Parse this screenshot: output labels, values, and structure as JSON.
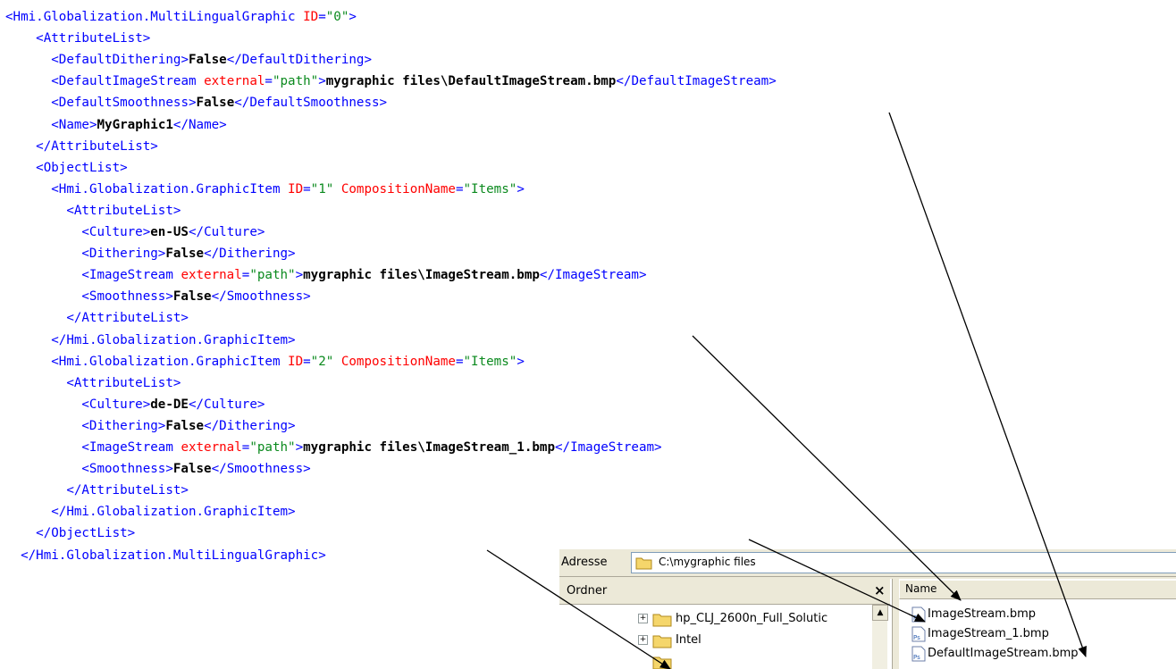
{
  "code_lines": [
    {
      "indent": 0,
      "parts": [
        {
          "t": "tag",
          "v": "<Hmi.Globalization.MultiLingualGraphic "
        },
        {
          "t": "attr",
          "v": "ID"
        },
        {
          "t": "tag",
          "v": "="
        },
        {
          "t": "val",
          "v": "\"0\""
        },
        {
          "t": "tag",
          "v": ">"
        }
      ]
    },
    {
      "indent": 4,
      "parts": [
        {
          "t": "tag",
          "v": "<AttributeList>"
        }
      ]
    },
    {
      "indent": 6,
      "parts": [
        {
          "t": "tag",
          "v": "<DefaultDithering>"
        },
        {
          "t": "txt",
          "v": "False"
        },
        {
          "t": "tag",
          "v": "</DefaultDithering>"
        }
      ]
    },
    {
      "indent": 6,
      "parts": [
        {
          "t": "tag",
          "v": "<DefaultImageStream "
        },
        {
          "t": "attr",
          "v": "external"
        },
        {
          "t": "tag",
          "v": "="
        },
        {
          "t": "val",
          "v": "\"path\""
        },
        {
          "t": "tag",
          "v": ">"
        },
        {
          "t": "txt",
          "v": "mygraphic files\\DefaultImageStream.bmp"
        },
        {
          "t": "tag",
          "v": "</DefaultImageStream>"
        }
      ]
    },
    {
      "indent": 6,
      "parts": [
        {
          "t": "tag",
          "v": "<DefaultSmoothness>"
        },
        {
          "t": "txt",
          "v": "False"
        },
        {
          "t": "tag",
          "v": "</DefaultSmoothness>"
        }
      ]
    },
    {
      "indent": 6,
      "parts": [
        {
          "t": "tag",
          "v": "<Name>"
        },
        {
          "t": "txt",
          "v": "MyGraphic1"
        },
        {
          "t": "tag",
          "v": "</Name>"
        }
      ]
    },
    {
      "indent": 4,
      "parts": [
        {
          "t": "tag",
          "v": "</AttributeList>"
        }
      ]
    },
    {
      "indent": 4,
      "parts": [
        {
          "t": "tag",
          "v": "<ObjectList>"
        }
      ]
    },
    {
      "indent": 6,
      "parts": [
        {
          "t": "tag",
          "v": "<Hmi.Globalization.GraphicItem "
        },
        {
          "t": "attr",
          "v": "ID"
        },
        {
          "t": "tag",
          "v": "="
        },
        {
          "t": "val",
          "v": "\"1\""
        },
        {
          "t": "tag",
          "v": " "
        },
        {
          "t": "attr",
          "v": "CompositionName"
        },
        {
          "t": "tag",
          "v": "="
        },
        {
          "t": "val",
          "v": "\"Items\""
        },
        {
          "t": "tag",
          "v": ">"
        }
      ]
    },
    {
      "indent": 8,
      "parts": [
        {
          "t": "tag",
          "v": "<AttributeList>"
        }
      ]
    },
    {
      "indent": 10,
      "parts": [
        {
          "t": "tag",
          "v": "<Culture>"
        },
        {
          "t": "txt",
          "v": "en-US"
        },
        {
          "t": "tag",
          "v": "</Culture>"
        }
      ]
    },
    {
      "indent": 10,
      "parts": [
        {
          "t": "tag",
          "v": "<Dithering>"
        },
        {
          "t": "txt",
          "v": "False"
        },
        {
          "t": "tag",
          "v": "</Dithering>"
        }
      ]
    },
    {
      "indent": 10,
      "parts": [
        {
          "t": "tag",
          "v": "<ImageStream "
        },
        {
          "t": "attr",
          "v": "external"
        },
        {
          "t": "tag",
          "v": "="
        },
        {
          "t": "val",
          "v": "\"path\""
        },
        {
          "t": "tag",
          "v": ">"
        },
        {
          "t": "txt",
          "v": "mygraphic files\\ImageStream.bmp"
        },
        {
          "t": "tag",
          "v": "</ImageStream>"
        }
      ]
    },
    {
      "indent": 10,
      "parts": [
        {
          "t": "tag",
          "v": "<Smoothness>"
        },
        {
          "t": "txt",
          "v": "False"
        },
        {
          "t": "tag",
          "v": "</Smoothness>"
        }
      ]
    },
    {
      "indent": 8,
      "parts": [
        {
          "t": "tag",
          "v": "</AttributeList>"
        }
      ]
    },
    {
      "indent": 6,
      "parts": [
        {
          "t": "tag",
          "v": "</Hmi.Globalization.GraphicItem>"
        }
      ]
    },
    {
      "indent": 6,
      "parts": [
        {
          "t": "tag",
          "v": "<Hmi.Globalization.GraphicItem "
        },
        {
          "t": "attr",
          "v": "ID"
        },
        {
          "t": "tag",
          "v": "="
        },
        {
          "t": "val",
          "v": "\"2\""
        },
        {
          "t": "tag",
          "v": " "
        },
        {
          "t": "attr",
          "v": "CompositionName"
        },
        {
          "t": "tag",
          "v": "="
        },
        {
          "t": "val",
          "v": "\"Items\""
        },
        {
          "t": "tag",
          "v": ">"
        }
      ]
    },
    {
      "indent": 8,
      "parts": [
        {
          "t": "tag",
          "v": "<AttributeList>"
        }
      ]
    },
    {
      "indent": 10,
      "parts": [
        {
          "t": "tag",
          "v": "<Culture>"
        },
        {
          "t": "txt",
          "v": "de-DE"
        },
        {
          "t": "tag",
          "v": "</Culture>"
        }
      ]
    },
    {
      "indent": 10,
      "parts": [
        {
          "t": "tag",
          "v": "<Dithering>"
        },
        {
          "t": "txt",
          "v": "False"
        },
        {
          "t": "tag",
          "v": "</Dithering>"
        }
      ]
    },
    {
      "indent": 10,
      "parts": [
        {
          "t": "tag",
          "v": "<ImageStream "
        },
        {
          "t": "attr",
          "v": "external"
        },
        {
          "t": "tag",
          "v": "="
        },
        {
          "t": "val",
          "v": "\"path\""
        },
        {
          "t": "tag",
          "v": ">"
        },
        {
          "t": "txt",
          "v": "mygraphic files\\ImageStream_1.bmp"
        },
        {
          "t": "tag",
          "v": "</ImageStream>"
        }
      ]
    },
    {
      "indent": 10,
      "parts": [
        {
          "t": "tag",
          "v": "<Smoothness>"
        },
        {
          "t": "txt",
          "v": "False"
        },
        {
          "t": "tag",
          "v": "</Smoothness>"
        }
      ]
    },
    {
      "indent": 8,
      "parts": [
        {
          "t": "tag",
          "v": "</AttributeList>"
        }
      ]
    },
    {
      "indent": 6,
      "parts": [
        {
          "t": "tag",
          "v": "</Hmi.Globalization.GraphicItem>"
        }
      ]
    },
    {
      "indent": 4,
      "parts": [
        {
          "t": "tag",
          "v": "</ObjectList>"
        }
      ]
    },
    {
      "indent": 2,
      "parts": [
        {
          "t": "tag",
          "v": "</Hmi.Globalization.MultiLingualGraphic>"
        }
      ]
    }
  ],
  "explorer": {
    "address_label": "Adresse",
    "address_path": "C:\\mygraphic files",
    "folder_pane_title": "Ordner",
    "folder_pane_close": "×",
    "tree_items": [
      {
        "label": "hp_CLJ_2600n_Full_Solutic",
        "expander": "+"
      },
      {
        "label": "Intel",
        "expander": "+"
      }
    ],
    "scroll_up": "▲",
    "column_name": "Name",
    "files": [
      "ImageStream.bmp",
      "ImageStream_1.bmp",
      "DefaultImageStream.bmp"
    ],
    "file_icon_text": "Ps"
  },
  "colors": {
    "xml_tag": "#0000ff",
    "xml_attribute": "#ff0000",
    "xml_value": "#0b8a1e",
    "xml_text": "#000000",
    "folder_yellow": "#f5d66b",
    "window_chrome": "#ece9d8"
  }
}
